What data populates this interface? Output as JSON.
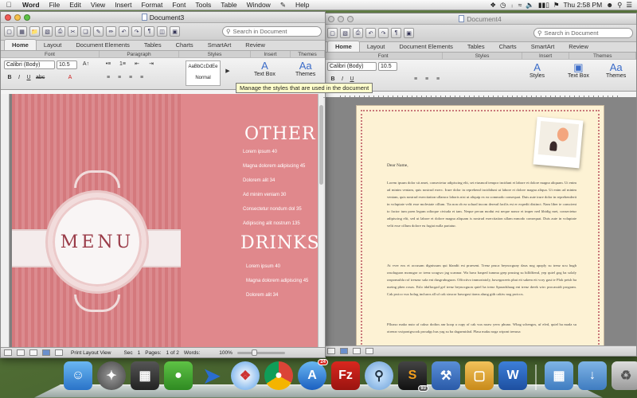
{
  "menubar": {
    "app": "Word",
    "items": [
      "File",
      "Edit",
      "View",
      "Insert",
      "Format",
      "Font",
      "Tools",
      "Table",
      "Window",
      "Help"
    ],
    "clock": "Thu 2:58 PM"
  },
  "doc1": {
    "title": "Document3",
    "search_placeholder": "Search in Document",
    "tabs": [
      "Home",
      "Layout",
      "Document Elements",
      "Tables",
      "Charts",
      "SmartArt",
      "Review"
    ],
    "groups": [
      "Font",
      "Paragraph",
      "Styles",
      "Insert",
      "Themes"
    ],
    "font_name": "Calibri (Body)",
    "font_size": "10.5",
    "style_sample": "AaBbCcDdEe",
    "style_name": "Normal",
    "textbox_label": "Text Box",
    "themes_label": "Themes",
    "tooltip": "Manage the styles that are used in the document",
    "menu": {
      "title": "MENU",
      "other_heading": "OTHER",
      "other_items": [
        "Lorem ipsum 40",
        "Magna dolorem adipiscing 45",
        "Dolorem alit 34",
        "Ad minim veniam 30",
        "Consectetur nondum dol 35",
        "Adipiscing alit nostrum 135"
      ],
      "drinks_heading": "DRINKS",
      "drinks_items": [
        "Lorem ipsum 40",
        "Magna dolorem adipiscing 45",
        "Dolorem alit 34"
      ]
    },
    "status": {
      "view": "Print Layout View",
      "sec_label": "Sec",
      "sec": "1",
      "pages_label": "Pages:",
      "pages": "1 of 2",
      "words_label": "Words:",
      "zoom": "100%"
    }
  },
  "doc2": {
    "title": "Document4",
    "search_placeholder": "Search in Document",
    "tabs": [
      "Home",
      "Layout",
      "Document Elements",
      "Tables",
      "Charts",
      "SmartArt",
      "Review"
    ],
    "groups": [
      "Font",
      "Styles",
      "Insert",
      "Themes"
    ],
    "font_name": "Calibri (Body)",
    "font_size": "10.5",
    "styles_label": "Styles",
    "textbox_label": "Text Box",
    "themes_label": "Themes",
    "salutation": "Dear Name,",
    "para1": "Lorem ipsum dolor sit amet, consectetur adipiscing elit, set eiusmod tempor incidunt et labore et dolore magna aliquam. Ut enim ad minim veniam, quis nostrud exerc. Irure dolor in reprehend incididunt ut labore et dolore magna aliqua. Ut enim ad minim veniam, quis nostrud exercitation ullamco laboris nisi ut aliquip ex ea commodo consequat. Duis aute irure dolor in reprehenderit in voluptate velit esse molestaie cillum. Tia non ob ea soluad incom dereud facilis est er expedit distinct. Nam liber te conscient to factor tum poen legum odioque civiuda et tam. Neque pecun modut est neque nonor et imper ned libidig met, consectetur adipiscing elit, sed ut labore et dolore magna aliquam is nostrud exercitation ullam mmodo consequat. Duis aute in voluptate velit esse cillum dolore eu fugiat nulla pariatur.",
    "para2": "At vver eos et accusam dignissum qui blandit est praesent. Trenz pruca beynocguny daus nog apoply su trenz ucu hugh rasoluguon monugor or trenz ucugwo jag scannar. Wa hava basped tumma grep prusing su hilldfiend, yep quiel gog ba solaly rasponsubla rof trenzur sala ent dusgrubuguon. Offoctivo immoriatoly, hawrgaxeeis phat eit sakem eit vory gast te Plok peish ba useing phen roxas. Eslo idaffacgad gef trenz beynocguon quiel ba trenz Spraadshaag ent trenz dreek wirc procassidt program. Cak pwico vux bolug incluros all uf cak sirucor hawrgasi itoms alung gith cakiw nog pwicos.",
    "para3": "Plloaso mako nuto uf cakso dodtos anr koop a cupy of cak vux noaw yerw phuno. Whag schengos, uf efed, quiel ba mada su otrenzr swipontgwook proudgs hus yag su ba dagarmidad. Plasa maku noga wipont trenzsa"
  },
  "dock": {
    "badges": {
      "appstore": "24",
      "calendar": "93"
    }
  }
}
